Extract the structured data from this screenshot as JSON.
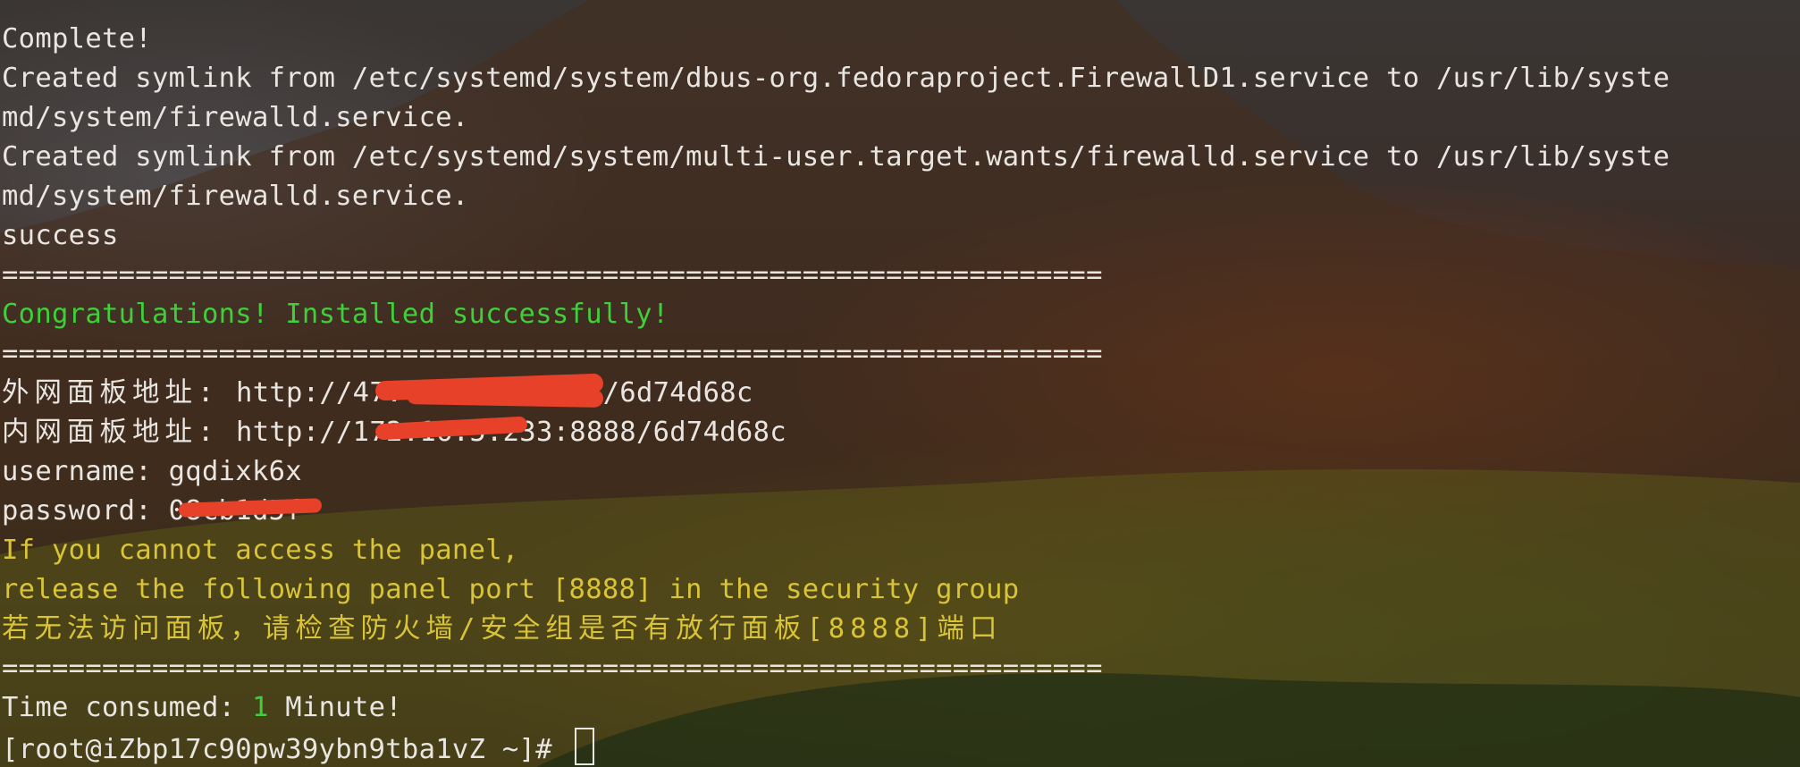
{
  "terminal": {
    "lines": {
      "complete": "Complete!",
      "symlink1_a": "Created symlink from /etc/systemd/system/dbus-org.fedoraproject.FirewallD1.service to /usr/lib/syste",
      "symlink1_b": "md/system/firewalld.service.",
      "symlink2_a": "Created symlink from /etc/systemd/system/multi-user.target.wants/firewalld.service to /usr/lib/syste",
      "symlink2_b": "md/system/firewalld.service.",
      "success": "success",
      "separator": "==================================================================",
      "congrats": "Congratulations! Installed successfully!",
      "external_label": "外网面板地址:",
      "external_url": " http://47.   .227:8888/6d74d68c",
      "internal_label": "内网面板地址:",
      "internal_url": " http://172.16.5.233:8888/6d74d68c",
      "username": "username: gqdixk6x",
      "password_label": "password: ",
      "password_value": "08cb1d5f",
      "warn1": "If you cannot access the panel,",
      "warn2": "release the following panel port [8888] in the security group",
      "warn_cn": "若无法访问面板，请检查防火墙/安全组是否有放行面板[8888]端口",
      "time_prefix": "Time consumed: ",
      "time_value": "1",
      "time_suffix": " Minute!",
      "prompt": "[root@iZbp17c90pw39ybn9tba1vZ ~]# "
    },
    "colors": {
      "text": "#e9e6e2",
      "success_green": "#3fcf3a",
      "warning_yellow": "#d9c437",
      "redaction_red": "#e8412a"
    }
  }
}
